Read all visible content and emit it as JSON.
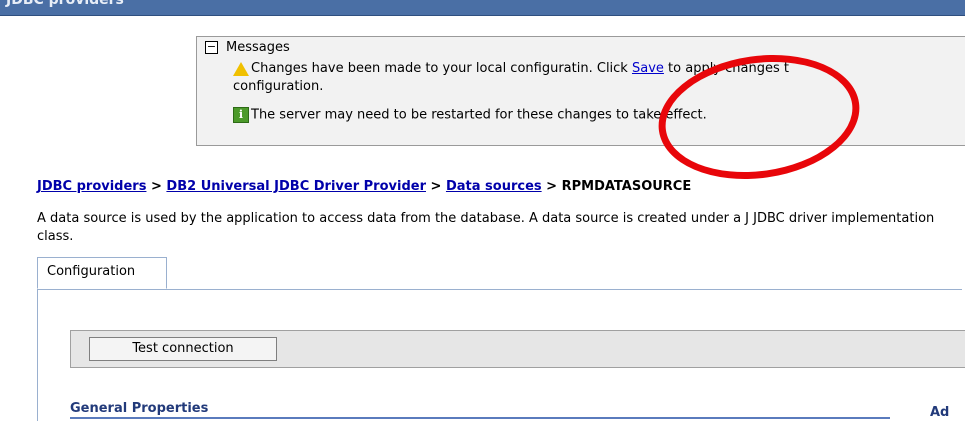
{
  "window": {
    "title": "JDBC providers"
  },
  "messages": {
    "title": "Messages",
    "warning_pre": "Changes have been made to your local configurati",
    "warning_mid": "n. Click ",
    "save_link": "Save",
    "warning_post": " to apply changes t",
    "warning_line2": "configuration.",
    "info": "The server may need to be restarted for these changes to take effect."
  },
  "breadcrumb": {
    "items": [
      "JDBC providers",
      "DB2 Universal JDBC Driver Provider",
      "Data sources"
    ],
    "separator": ">",
    "current": "RPMDATASOURCE"
  },
  "description": "A data source is used by the application to access data from the database. A data source is created under a J JDBC driver implementation class.",
  "tabs": [
    "Configuration"
  ],
  "buttons": {
    "test_connection": "Test connection"
  },
  "sections": {
    "general": "General Properties",
    "additional": "Ad"
  },
  "colors": {
    "annotation": "#e8060a",
    "link": "#0000cc",
    "title_bar": "#4a6fa5"
  }
}
